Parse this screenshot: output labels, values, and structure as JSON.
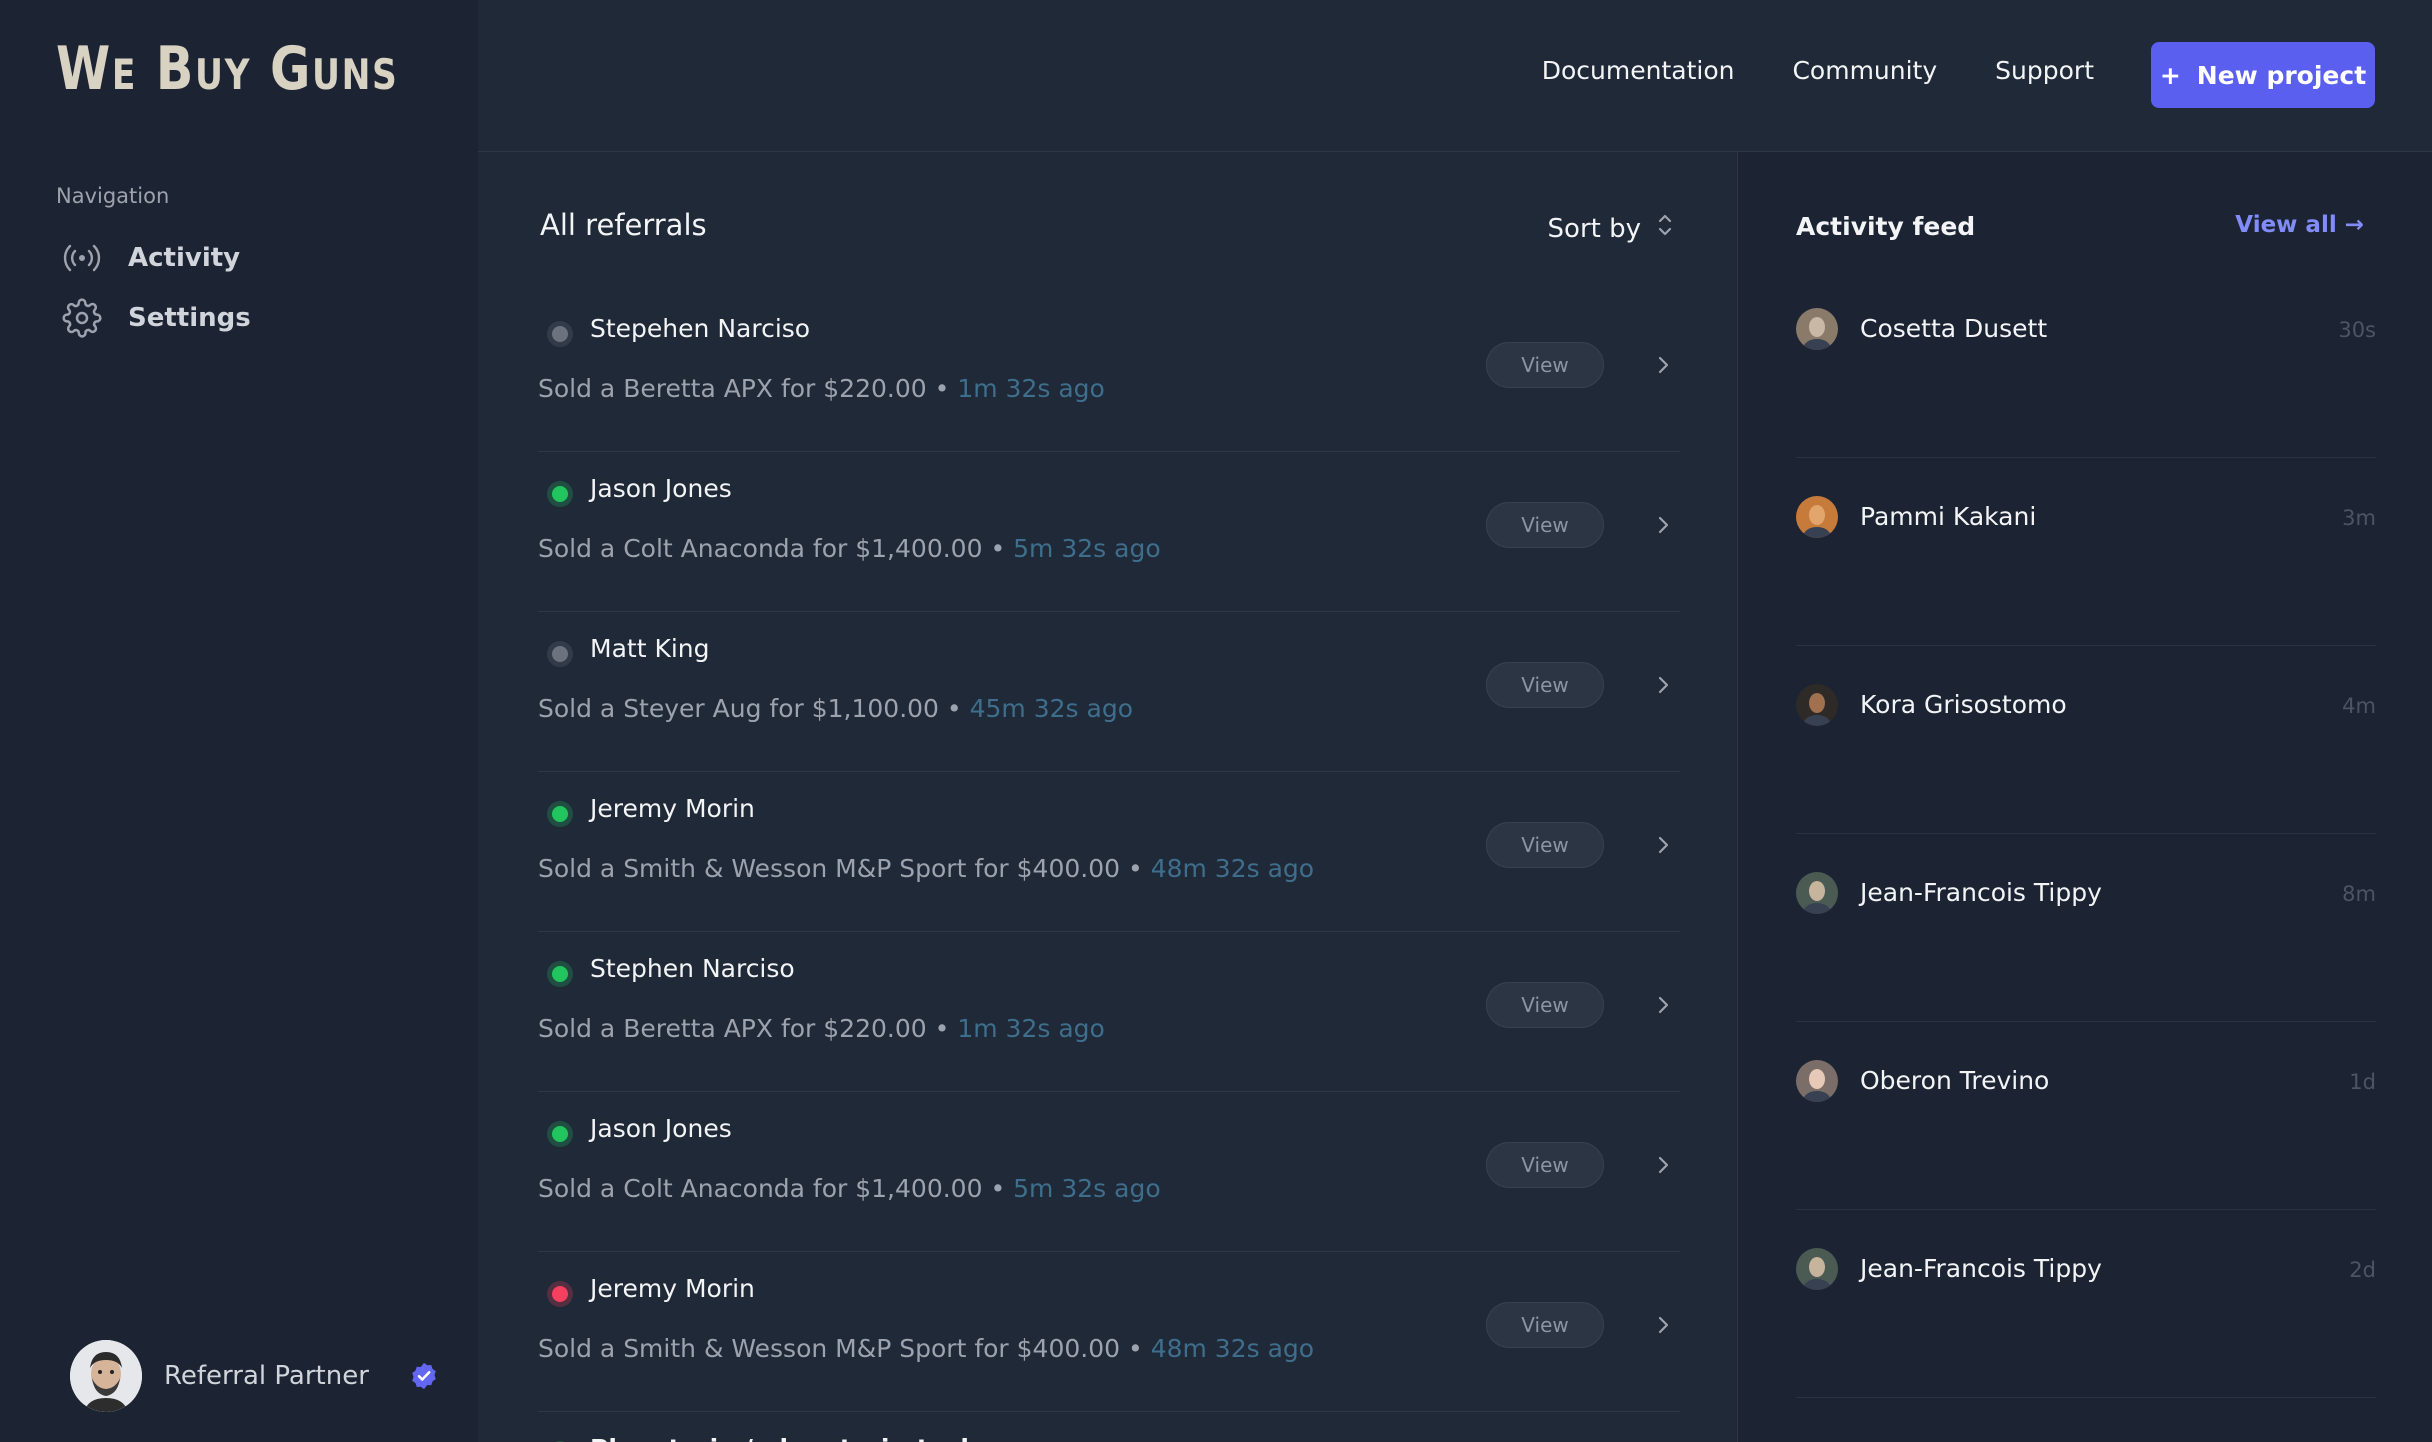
{
  "sidebar": {
    "logo": "We Buy Guns",
    "nav_heading": "Navigation",
    "items": [
      {
        "label": "Activity",
        "icon": "broadcast-icon"
      },
      {
        "label": "Settings",
        "icon": "gear-icon"
      }
    ],
    "profile": {
      "name": "Referral Partner",
      "badge": "verified-badge-icon"
    }
  },
  "topbar": {
    "links": [
      "Documentation",
      "Community",
      "Support"
    ],
    "new_project": "New project",
    "new_project_prefix": "+"
  },
  "main": {
    "title": "All referrals",
    "sort_label": "Sort by",
    "view_label": "View",
    "rows": [
      {
        "name": "Stepehen Narciso",
        "status": "gray",
        "desc": "Sold a Beretta APX for $220.00",
        "sep": "•",
        "time": "1m 32s ago"
      },
      {
        "name": "Jason Jones",
        "status": "green",
        "desc": "Sold a Colt Anaconda for $1,400.00",
        "sep": "•",
        "time": "5m 32s ago"
      },
      {
        "name": "Matt King",
        "status": "gray",
        "desc": "Sold a Steyer Aug for $1,100.00",
        "sep": "•",
        "time": "45m 32s ago"
      },
      {
        "name": "Jeremy Morin",
        "status": "green",
        "desc": "Sold a Smith & Wesson M&P Sport for $400.00",
        "sep": "•",
        "time": "48m 32s ago"
      },
      {
        "name": "Stephen Narciso",
        "status": "green",
        "desc": "Sold a Beretta APX for $220.00",
        "sep": "•",
        "time": "1m 32s ago"
      },
      {
        "name": "Jason Jones",
        "status": "green",
        "desc": "Sold a Colt Anaconda for $1,400.00",
        "sep": "•",
        "time": "5m 32s ago"
      },
      {
        "name": "Jeremy Morin",
        "status": "red",
        "desc": "Sold a Smith & Wesson M&P Sport for $400.00",
        "sep": "•",
        "time": "48m 32s ago"
      }
    ],
    "partial_row": {
      "name": "Planetaria / planetaria-tech",
      "status": "green"
    }
  },
  "feed": {
    "title": "Activity feed",
    "view_all": "View all →",
    "items": [
      {
        "name": "Cosetta Dusett",
        "time": "30s"
      },
      {
        "name": "Pammi Kakani",
        "time": "3m"
      },
      {
        "name": "Kora Grisostomo",
        "time": "4m"
      },
      {
        "name": "Jean-Francois Tippy",
        "time": "8m"
      },
      {
        "name": "Oberon Trevino",
        "time": "1d"
      },
      {
        "name": "Jean-Francois Tippy",
        "time": "2d"
      }
    ]
  },
  "colors": {
    "status_green": "#22c55e",
    "status_gray": "#6b7280",
    "status_red": "#f43f5e",
    "accent": "#5b5ff0",
    "link": "#818cf8"
  }
}
